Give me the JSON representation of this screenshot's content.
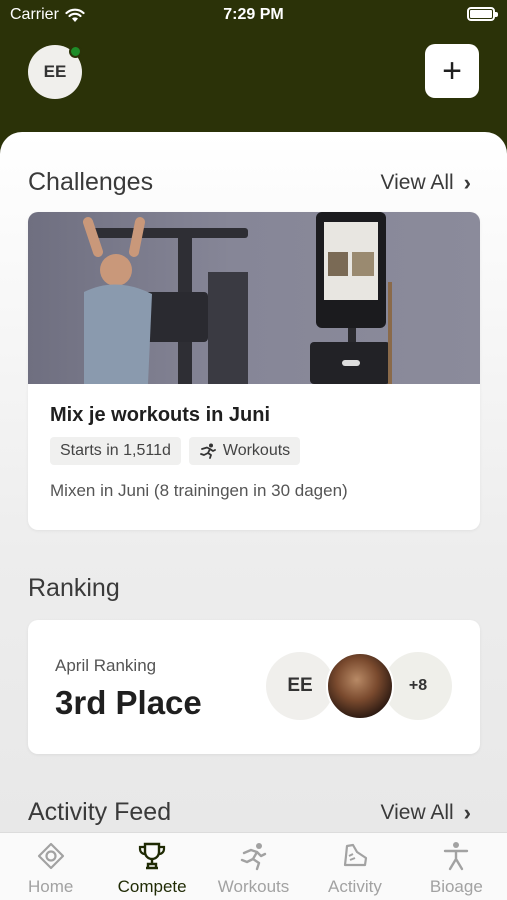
{
  "status_bar": {
    "carrier": "Carrier",
    "time": "7:29 PM"
  },
  "header": {
    "avatar_initials": "EE",
    "add_label": "+"
  },
  "challenges": {
    "title": "Challenges",
    "view_all": "View All",
    "card": {
      "title": "Mix je workouts in Juni",
      "chip_start": "Starts in 1,511d",
      "chip_type": "Workouts",
      "description": "Mixen in Juni (8 trainingen in 30 dagen)"
    }
  },
  "ranking": {
    "title": "Ranking",
    "subtitle": "April Ranking",
    "place": "3rd Place",
    "avatar_initials": "EE",
    "more_count": "+8"
  },
  "activity_feed": {
    "title": "Activity Feed",
    "view_all": "View All"
  },
  "tabs": [
    {
      "label": "Home",
      "icon": "home-icon"
    },
    {
      "label": "Compete",
      "icon": "trophy-icon"
    },
    {
      "label": "Workouts",
      "icon": "runner-icon"
    },
    {
      "label": "Activity",
      "icon": "activity-icon"
    },
    {
      "label": "Bioage",
      "icon": "person-icon"
    }
  ],
  "colors": {
    "header_bg": "#2b3208",
    "active_tab": "#1f2a04",
    "inactive_tab": "#a2a2a2",
    "online": "#1e8c28"
  }
}
